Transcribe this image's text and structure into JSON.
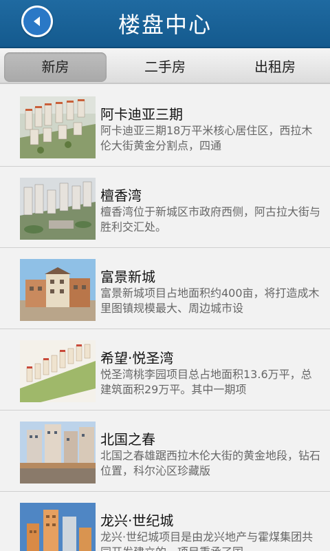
{
  "header": {
    "title": "楼盘中心",
    "back_icon": "arrow-left-icon",
    "accent": "#1a64a0"
  },
  "tabs": [
    {
      "label": "新房",
      "active": true
    },
    {
      "label": "二手房",
      "active": false
    },
    {
      "label": "出租房",
      "active": false
    }
  ],
  "listings": [
    {
      "title": "阿卡迪亚三期",
      "desc": "阿卡迪亚三期18万平米核心居住区，西拉木伦大街黄金分割点，四通"
    },
    {
      "title": "檀香湾",
      "desc": "檀香湾位于新城区市政府西侧，阿古拉大街与胜利交汇处。"
    },
    {
      "title": "富景新城",
      "desc": "富景新城项目占地面积约400亩，将打造成木里图镇规模最大、周边城市设"
    },
    {
      "title": "希望·悦圣湾",
      "desc": "悦圣湾桃李园项目总占地面积13.6万平，总建筑面积29万平。其中一期项"
    },
    {
      "title": "北国之春",
      "desc": "北国之春雄踞西拉木伦大街的黄金地段，钻石位置，科尔沁区珍藏版"
    },
    {
      "title": "龙兴·世纪城",
      "desc": "龙兴·世纪城项目是由龙兴地产与霍煤集团共同开发建立的，项目秉承了国"
    }
  ]
}
